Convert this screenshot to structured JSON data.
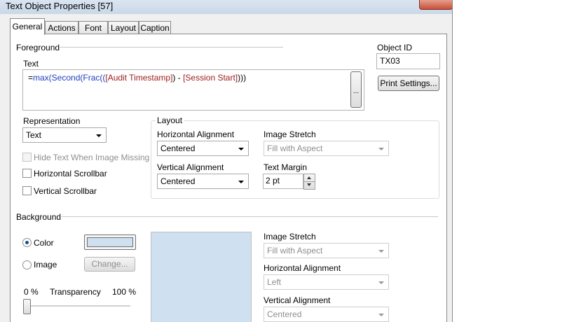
{
  "window": {
    "title": "Text Object Properties [57]"
  },
  "tabs": [
    "General",
    "Actions",
    "Font",
    "Layout",
    "Caption"
  ],
  "active_tab": "General",
  "foreground": {
    "group_label": "Foreground",
    "text_label": "Text",
    "expression": {
      "p1": "=",
      "p2": "max(Second(Frac((",
      "p3": "[Audit Timestamp]",
      "p4": ") - ",
      "p5": "[Session Start]",
      "p6": ")))"
    },
    "ellipsis_label": "...",
    "object_id_label": "Object ID",
    "object_id_value": "TX03",
    "print_settings_label": "Print Settings...",
    "representation_label": "Representation",
    "representation_value": "Text",
    "hide_text_label": "Hide Text When Image Missing",
    "horizontal_scrollbar_label": "Horizontal Scrollbar",
    "vertical_scrollbar_label": "Vertical Scrollbar",
    "layout": {
      "group_label": "Layout",
      "horizontal_alignment_label": "Horizontal Alignment",
      "horizontal_alignment_value": "Centered",
      "image_stretch_label": "Image Stretch",
      "image_stretch_value": "Fill with Aspect",
      "vertical_alignment_label": "Vertical Alignment",
      "vertical_alignment_value": "Centered",
      "text_margin_label": "Text Margin",
      "text_margin_value": "2 pt"
    }
  },
  "background": {
    "group_label": "Background",
    "color_label": "Color",
    "image_label": "Image",
    "change_label": "Change...",
    "transparency_min": "0 %",
    "transparency_label": "Transparency",
    "transparency_max": "100 %",
    "transparency_level": 0,
    "swatch_color": "#cfe0f1",
    "image_stretch_label": "Image Stretch",
    "image_stretch_value": "Fill with Aspect",
    "horizontal_alignment_label": "Horizontal Alignment",
    "horizontal_alignment_value": "Left",
    "vertical_alignment_label": "Vertical Alignment",
    "vertical_alignment_value": "Centered"
  }
}
